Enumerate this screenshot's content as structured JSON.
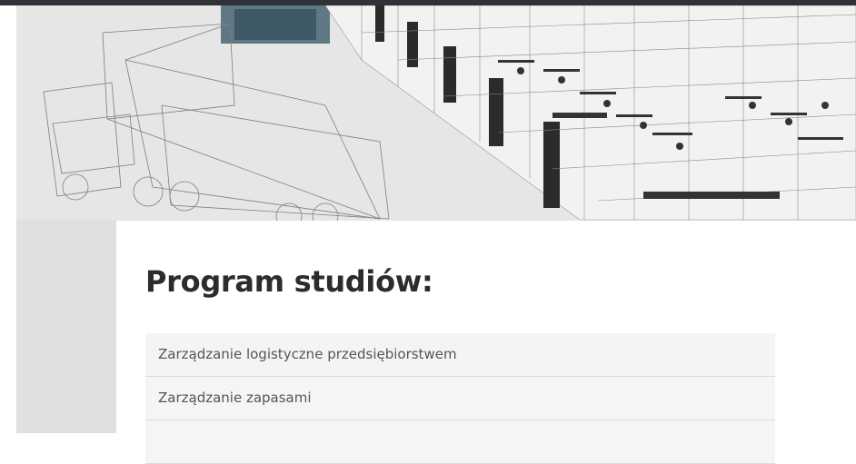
{
  "hero": {
    "image_description_icon": "warehouse-wireframe-illustration"
  },
  "program": {
    "title": "Program studiów:",
    "items": [
      "Zarządzanie logistyczne przedsiębiorstwem",
      "Zarządzanie zapasami",
      ""
    ]
  },
  "colors": {
    "top_bar": "#2f3337",
    "title": "#2c2c2c",
    "item_text": "#555555",
    "item_bg": "#f5f5f5"
  }
}
